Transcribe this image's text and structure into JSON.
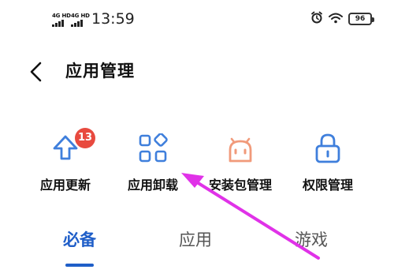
{
  "status_bar": {
    "signal_1": "4G HD",
    "signal_2": "4G HD",
    "time": "13:59",
    "battery": "96",
    "icons": [
      "alarm-icon",
      "wifi-icon",
      "battery-icon"
    ]
  },
  "header": {
    "back_icon": "back-arrow-icon",
    "title": "应用管理"
  },
  "shortcuts": [
    {
      "label": "应用更新",
      "icon": "upload-arrow-icon",
      "badge": "13"
    },
    {
      "label": "应用卸载",
      "icon": "apps-grid-icon"
    },
    {
      "label": "安装包管理",
      "icon": "android-package-icon"
    },
    {
      "label": "权限管理",
      "icon": "lock-icon"
    }
  ],
  "tabs": [
    {
      "label": "必备",
      "active": true
    },
    {
      "label": "应用",
      "active": false
    },
    {
      "label": "游戏",
      "active": false
    }
  ],
  "colors": {
    "accent": "#1f5ec8",
    "badge": "#e84a3f",
    "annotation_arrow": "#e032e8",
    "icon_blue": "#3f7fdc",
    "icon_orange": "#f19a7a"
  }
}
